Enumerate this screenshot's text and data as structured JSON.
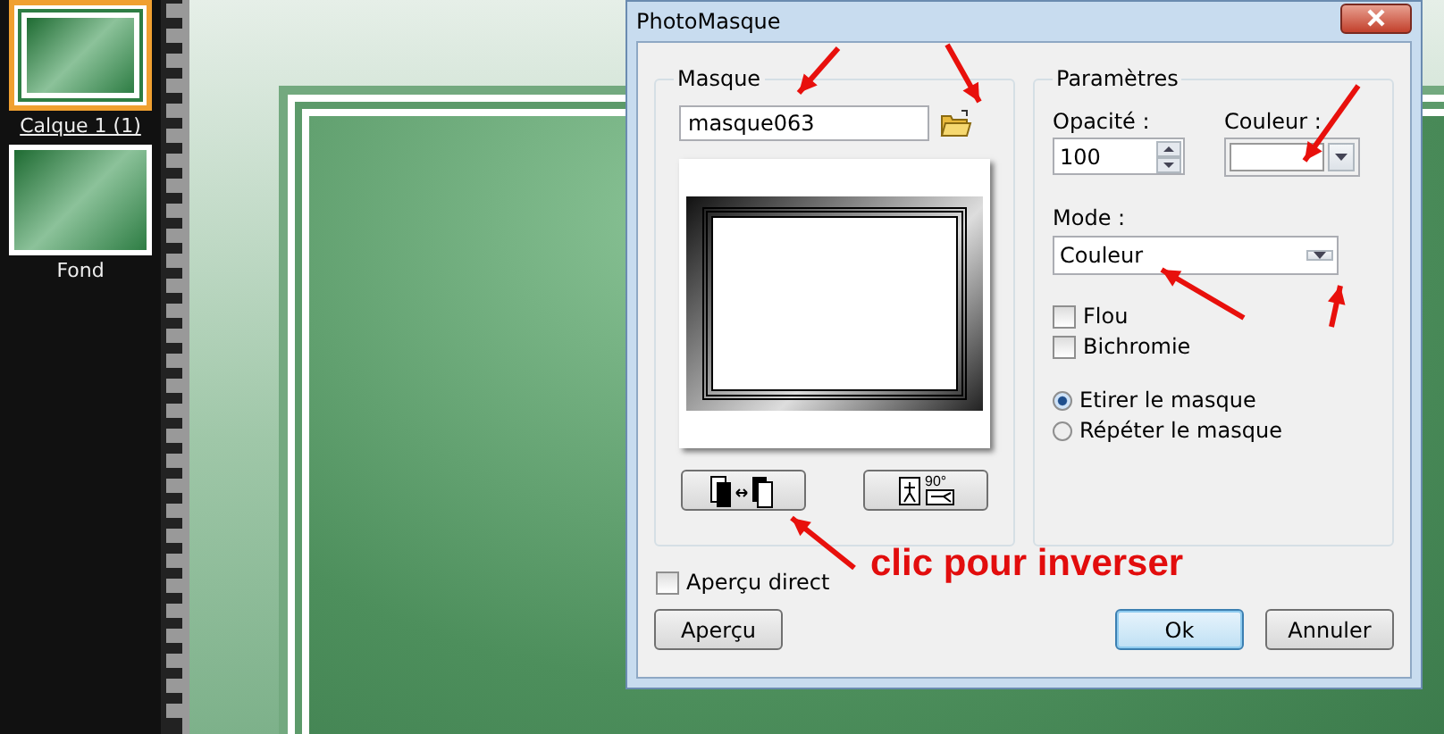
{
  "layers": [
    {
      "label": "Calque 1 (1)",
      "selected": true
    },
    {
      "label": "Fond",
      "selected": false
    }
  ],
  "dialog": {
    "title": "PhotoMasque",
    "mask_group": {
      "title": "Masque",
      "field_value": "masque063",
      "rotate_button_label": "90°"
    },
    "params_group": {
      "title": "Paramètres",
      "opacity_label": "Opacité :",
      "opacity_value": "100",
      "color_label": "Couleur :",
      "mode_label": "Mode :",
      "mode_value": "Couleur",
      "checkboxes": [
        {
          "label": "Flou",
          "checked": false
        },
        {
          "label": "Bichromie",
          "checked": false
        }
      ],
      "radios": [
        {
          "label": "Etirer le masque",
          "selected": true
        },
        {
          "label": "Répéter le masque",
          "selected": false
        }
      ]
    },
    "live_preview": {
      "label": "Aperçu direct",
      "checked": false
    },
    "buttons": [
      {
        "label": "Aperçu",
        "default": false
      },
      {
        "label": "Ok",
        "default": true
      },
      {
        "label": "Annuler",
        "default": false
      }
    ]
  },
  "annotation": {
    "text": "clic pour inverser"
  }
}
